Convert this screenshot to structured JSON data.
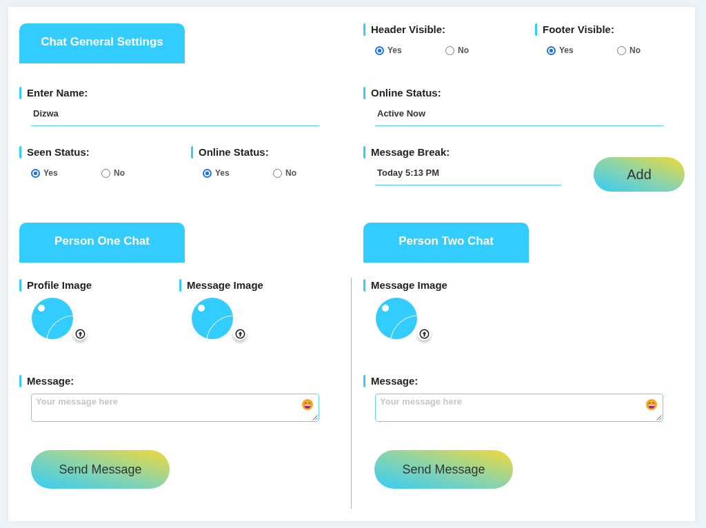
{
  "general_settings": {
    "title": "Chat General Settings",
    "header_visible": {
      "label": "Header Visible:",
      "options": [
        {
          "label": "Yes",
          "selected": true
        },
        {
          "label": "No",
          "selected": false
        }
      ]
    },
    "footer_visible": {
      "label": "Footer Visible:",
      "options": [
        {
          "label": "Yes",
          "selected": true
        },
        {
          "label": "No",
          "selected": false
        }
      ]
    },
    "name": {
      "label": "Enter Name:",
      "value": "Dizwa"
    },
    "online_status_text": {
      "label": "Online Status:",
      "value": "Active Now"
    },
    "seen_status": {
      "label": "Seen Status:",
      "options": [
        {
          "label": "Yes",
          "selected": true
        },
        {
          "label": "No",
          "selected": false
        }
      ]
    },
    "online_status": {
      "label": "Online Status:",
      "options": [
        {
          "label": "Yes",
          "selected": true
        },
        {
          "label": "No",
          "selected": false
        }
      ]
    },
    "message_break": {
      "label": "Message Break:",
      "value": "Today 5:13 PM"
    },
    "add_button": "Add"
  },
  "person_one_chat": {
    "title": "Person One Chat",
    "images": [
      {
        "label": "Profile Image"
      },
      {
        "label": "Message Image"
      }
    ],
    "message": {
      "label": "Message:",
      "placeholder": "Your message here"
    },
    "send_button": "Send Message"
  },
  "person_two_chat": {
    "title": "Person Two Chat",
    "images": [
      {
        "label": "Message Image"
      }
    ],
    "message": {
      "label": "Message:",
      "placeholder": "Your message here"
    },
    "send_button": "Send Message"
  }
}
